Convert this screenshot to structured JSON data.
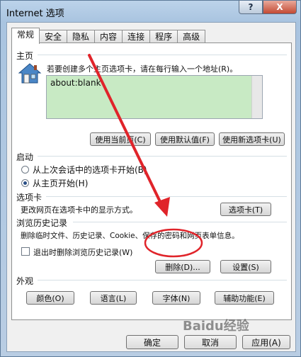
{
  "window": {
    "title": "Internet 选项",
    "help_label": "?",
    "close_label": "X"
  },
  "tabs": [
    {
      "label": "常规",
      "active": true
    },
    {
      "label": "安全"
    },
    {
      "label": "隐私"
    },
    {
      "label": "内容"
    },
    {
      "label": "连接"
    },
    {
      "label": "程序"
    },
    {
      "label": "高级"
    }
  ],
  "homepage": {
    "heading": "主页",
    "description": "若要创建多个主页选项卡，请在每行输入一个地址(R)。",
    "value": "about:blank",
    "buttons": [
      "使用当前页(C)",
      "使用默认值(F)",
      "使用新选项卡(U)"
    ]
  },
  "startup": {
    "heading": "启动",
    "option1": "从上次会话中的选项卡开始(B)",
    "option2": "从主页开始(H)",
    "selected": 2
  },
  "tabs_section": {
    "heading": "选项卡",
    "description": "更改网页在选项卡中的显示方式。",
    "button": "选项卡(T)"
  },
  "history": {
    "heading": "浏览历史记录",
    "description": "删除临时文件、历史记录、Cookie、保存的密码和网页表单信息。",
    "checkbox_label": "退出时删除浏览历史记录(W)",
    "delete_button": "删除(D)...",
    "settings_button": "设置(S)"
  },
  "appearance": {
    "heading": "外观",
    "buttons": [
      "颜色(O)",
      "语言(L)",
      "字体(N)",
      "辅助功能(E)"
    ]
  },
  "footer": {
    "ok": "确定",
    "cancel": "取消",
    "apply": "应用(A)"
  },
  "watermark": "Baidu经验",
  "colors": {
    "annotation": "#e0242a",
    "url_box": "#c8eac4"
  }
}
